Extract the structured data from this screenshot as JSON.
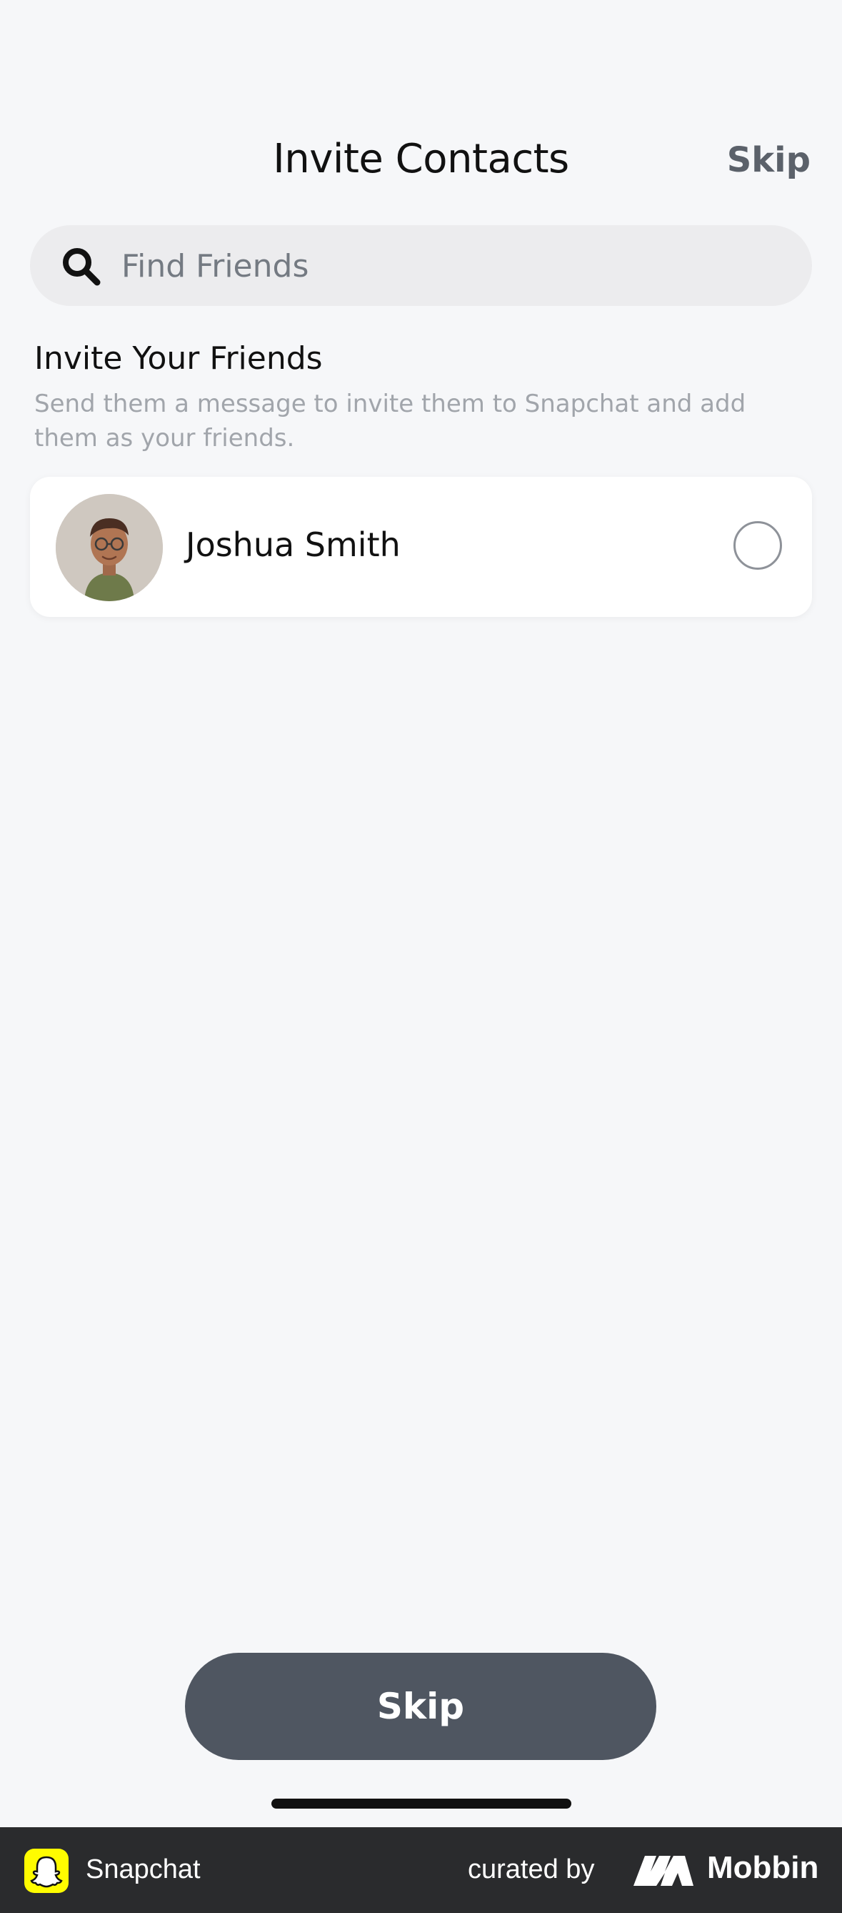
{
  "header": {
    "title": "Invite Contacts",
    "skip_label": "Skip"
  },
  "search": {
    "placeholder": "Find Friends",
    "value": "",
    "icon": "search-icon"
  },
  "section": {
    "title": "Invite Your Friends",
    "description": "Send them a message to invite them to Snapchat and add them as your friends."
  },
  "contacts": [
    {
      "name": "Joshua Smith",
      "selected": false,
      "avatar": "memoji-avatar"
    }
  ],
  "bottom": {
    "skip_button_label": "Skip"
  },
  "footer": {
    "app_name": "Snapchat",
    "curated_by": "curated by",
    "brand": "Mobbin"
  },
  "colors": {
    "background": "#f6f7f9",
    "search_bg": "#ececee",
    "skip_button_bg": "#4f5661",
    "header_skip": "#5b616a",
    "snapchat_yellow": "#fffc00",
    "footer_bg": "#2a2b2d"
  }
}
